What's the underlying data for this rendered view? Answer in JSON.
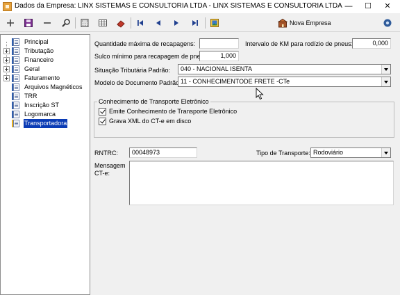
{
  "window": {
    "title": "Dados da Empresa: LINX SISTEMAS E CONSULTORIA LTDA - LINX SISTEMAS E CONSULTORIA LTDA",
    "minimize_glyph": "—",
    "maximize_glyph": "☐",
    "close_glyph": "✕"
  },
  "toolbar": {
    "nova_empresa_label": "Nova Empresa",
    "buttons": [
      "add-icon",
      "save-icon",
      "remove-icon",
      "search-icon",
      "calculator-icon",
      "grid-icon",
      "eraser-icon",
      "first-record-icon",
      "previous-record-icon",
      "next-record-icon",
      "last-record-icon",
      "image-icon",
      "new-company-icon",
      "gear-icon"
    ]
  },
  "tree": {
    "items": [
      {
        "label": "Principal",
        "expandable": false
      },
      {
        "label": "Tributação",
        "expandable": true
      },
      {
        "label": "Financeiro",
        "expandable": true
      },
      {
        "label": "Geral",
        "expandable": true
      },
      {
        "label": "Faturamento",
        "expandable": true
      },
      {
        "label": "Arquivos Magnéticos",
        "expandable": false
      },
      {
        "label": "TRR",
        "expandable": false
      },
      {
        "label": "Inscrição ST",
        "expandable": false
      },
      {
        "label": "Logomarca",
        "expandable": false
      },
      {
        "label": "Transportadora",
        "expandable": false,
        "selected": true
      }
    ]
  },
  "form": {
    "qtd_recapagens_label": "Quantidade máxima de recapagens:",
    "qtd_recapagens_value": "",
    "intervalo_km_label": "Intervalo de KM para rodízio de pneus:",
    "intervalo_km_value": "0,000",
    "sulco_label": "Sulco mínimo para recapagem de pneu:",
    "sulco_value": "1,000",
    "situacao_label": "Situação Tributária Padrão:",
    "situacao_value": "040 - NACIONAL ISENTA",
    "modelo_label": "Modelo de Documento Padrão:",
    "modelo_value": "11 - CONHECIMENTODE FRETE -CTe",
    "cte_group_title": "Conhecimento de Transporte Eletrônico",
    "emite_cte_label": "Emite Conhecimento de Transporte Eletrônico",
    "emite_cte_checked": true,
    "grava_xml_label": "Grava XML do CT-e em disco",
    "grava_xml_checked": true,
    "rntrc_label": "RNTRC:",
    "rntrc_value": "00048973",
    "tipo_transporte_label": "Tipo de Transporte:",
    "tipo_transporte_value": "Rodoviário",
    "mensagem_label_1": "Mensagem",
    "mensagem_label_2": "CT-e:",
    "mensagem_value": ""
  }
}
